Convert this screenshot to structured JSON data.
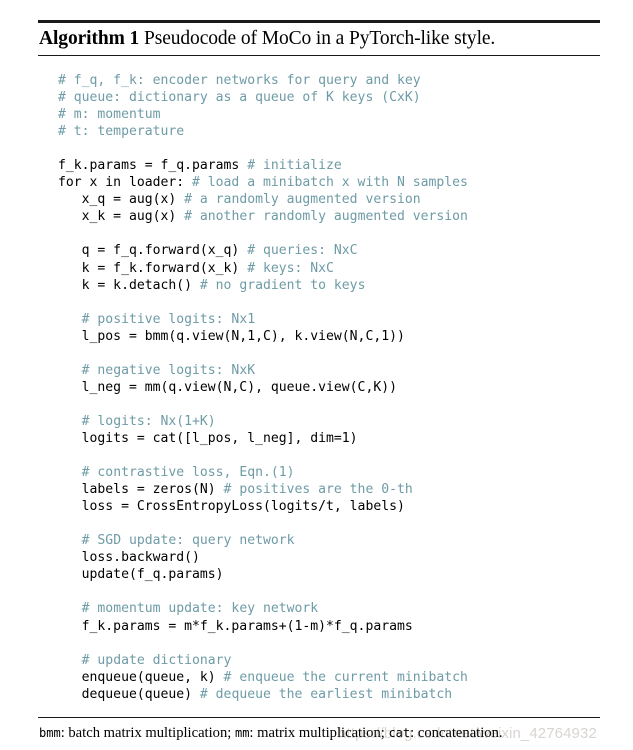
{
  "document": {
    "type": "algorithm-float",
    "title": {
      "name": "Algorithm 1",
      "description": "Pseudocode of MoCo in a PyTorch-like style."
    },
    "colors": {
      "comment": "#6e9ba6",
      "code": "#000000",
      "rule": "#1a1a1a",
      "watermark": "#d9d4d0",
      "background": "#ffffff"
    },
    "code_lines": [
      {
        "code": "",
        "comment": "# f_q, f_k: encoder networks for query and key"
      },
      {
        "code": "",
        "comment": "# queue: dictionary as a queue of K keys (CxK)"
      },
      {
        "code": "",
        "comment": "# m: momentum"
      },
      {
        "code": "",
        "comment": "# t: temperature"
      },
      {
        "code": "",
        "comment": ""
      },
      {
        "code": "f_k.params = f_q.params ",
        "comment": "# initialize"
      },
      {
        "code": "for x in loader: ",
        "comment": "# load a minibatch x with N samples"
      },
      {
        "code": "   x_q = aug(x) ",
        "comment": "# a randomly augmented version"
      },
      {
        "code": "   x_k = aug(x) ",
        "comment": "# another randomly augmented version"
      },
      {
        "code": "",
        "comment": ""
      },
      {
        "code": "   q = f_q.forward(x_q) ",
        "comment": "# queries: NxC"
      },
      {
        "code": "   k = f_k.forward(x_k) ",
        "comment": "# keys: NxC"
      },
      {
        "code": "   k = k.detach() ",
        "comment": "# no gradient to keys"
      },
      {
        "code": "",
        "comment": ""
      },
      {
        "code": "   ",
        "comment": "# positive logits: Nx1"
      },
      {
        "code": "   l_pos = bmm(q.view(N,1,C), k.view(N,C,1))",
        "comment": ""
      },
      {
        "code": "",
        "comment": ""
      },
      {
        "code": "   ",
        "comment": "# negative logits: NxK"
      },
      {
        "code": "   l_neg = mm(q.view(N,C), queue.view(C,K))",
        "comment": ""
      },
      {
        "code": "",
        "comment": ""
      },
      {
        "code": "   ",
        "comment": "# logits: Nx(1+K)"
      },
      {
        "code": "   logits = cat([l_pos, l_neg], dim=1)",
        "comment": ""
      },
      {
        "code": "",
        "comment": ""
      },
      {
        "code": "   ",
        "comment": "# contrastive loss, Eqn.(1)"
      },
      {
        "code": "   labels = zeros(N) ",
        "comment": "# positives are the 0-th"
      },
      {
        "code": "   loss = CrossEntropyLoss(logits/t, labels)",
        "comment": ""
      },
      {
        "code": "",
        "comment": ""
      },
      {
        "code": "   ",
        "comment": "# SGD update: query network"
      },
      {
        "code": "   loss.backward()",
        "comment": ""
      },
      {
        "code": "   update(f_q.params)",
        "comment": ""
      },
      {
        "code": "",
        "comment": ""
      },
      {
        "code": "   ",
        "comment": "# momentum update: key network"
      },
      {
        "code": "   f_k.params = m*f_k.params+(1-m)*f_q.params",
        "comment": ""
      },
      {
        "code": "",
        "comment": ""
      },
      {
        "code": "   ",
        "comment": "# update dictionary"
      },
      {
        "code": "   enqueue(queue, k) ",
        "comment": "# enqueue the current minibatch"
      },
      {
        "code": "   dequeue(queue) ",
        "comment": "# dequeue the earliest minibatch"
      }
    ],
    "footer": {
      "segments": [
        {
          "text": "bmm",
          "style": "tt"
        },
        {
          "text": ": batch matrix multiplication; ",
          "style": "serif"
        },
        {
          "text": "mm",
          "style": "tt"
        },
        {
          "text": ": matrix multiplication; ",
          "style": "serif"
        },
        {
          "text": "cat",
          "style": "tt"
        },
        {
          "text": ": concatenation.",
          "style": "serif"
        }
      ],
      "plain": "bmm: batch matrix multiplication; mm: matrix multiplication; cat: concatenation."
    },
    "watermark": {
      "text": "https://blog.csdn.net/weixin_42764932"
    }
  }
}
